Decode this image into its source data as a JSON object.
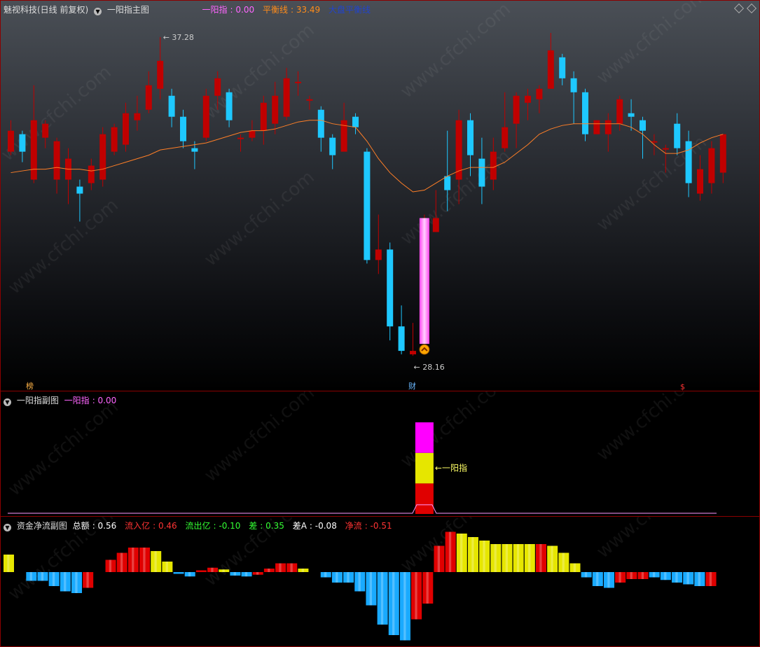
{
  "main": {
    "title": "魅视科技(日线 前复权)",
    "indicator_name": "一阳指主图",
    "legend": [
      {
        "label": "一阳指",
        "value": "0.00",
        "color": "#ff66ff"
      },
      {
        "label": "平衡线",
        "value": "33.49",
        "color": "#ff8c1a"
      },
      {
        "label": "大盘平衡线",
        "value": "",
        "color": "#2244cc"
      }
    ],
    "high_label": "37.28",
    "low_label": "28.16",
    "marker_bang": "榜",
    "marker_cai": "财",
    "marker_dollar": "$"
  },
  "sub1": {
    "indicator_name": "一阳指副图",
    "legend_label": "一阳指",
    "legend_value": "0.00",
    "annotation": "一阳指"
  },
  "sub2": {
    "indicator_name": "资金净流副图",
    "legend": [
      {
        "label": "总额",
        "value": "0.56",
        "color": "#ffffff"
      },
      {
        "label": "流入亿",
        "value": "0.46",
        "color": "#ff3333"
      },
      {
        "label": "流出亿",
        "value": "-0.10",
        "color": "#33ff33"
      },
      {
        "label": "差",
        "value": "0.35",
        "color": "#33ff33"
      },
      {
        "label": "差A",
        "value": "-0.08",
        "color": "#ffffff"
      },
      {
        "label": "净流",
        "value": "-0.51",
        "color": "#ff3333"
      }
    ]
  },
  "colors": {
    "up": "#c00000",
    "down": "#1ec8ff",
    "ma": "#ff7f27",
    "pink": "#ff66ff",
    "yellow": "#e6e600",
    "red": "#e00000",
    "blue": "#19aaff"
  },
  "watermark": "www.cfchi.com",
  "chart_data": [
    {
      "type": "candlestick",
      "ylim": [
        27.5,
        38.0
      ],
      "candles": [
        [
          34.0,
          34.6,
          34.9,
          33.9
        ],
        [
          34.5,
          34.0,
          34.6,
          33.7
        ],
        [
          33.2,
          34.9,
          35.9,
          33.1
        ],
        [
          34.4,
          34.8,
          34.9,
          34.1
        ],
        [
          33.2,
          34.3,
          34.4,
          32.8
        ],
        [
          33.2,
          33.8,
          34.1,
          32.5
        ],
        [
          33.0,
          32.8,
          33.2,
          32.0
        ],
        [
          33.1,
          33.6,
          33.8,
          32.9
        ],
        [
          33.2,
          34.5,
          34.7,
          33.0
        ],
        [
          34.0,
          34.7,
          34.8,
          33.9
        ],
        [
          34.2,
          35.1,
          35.4,
          34.0
        ],
        [
          34.9,
          35.1,
          35.6,
          34.6
        ],
        [
          35.2,
          35.9,
          36.3,
          35.1
        ],
        [
          35.8,
          36.6,
          37.28,
          35.5
        ],
        [
          35.6,
          35.0,
          35.8,
          34.7
        ],
        [
          35.0,
          34.3,
          35.2,
          34.1
        ],
        [
          34.1,
          34.0,
          34.3,
          33.5
        ],
        [
          34.4,
          35.6,
          35.8,
          34.3
        ],
        [
          35.6,
          36.1,
          36.3,
          35.2
        ],
        [
          35.7,
          34.9,
          35.8,
          34.7
        ],
        [
          34.4,
          34.4,
          34.5,
          34.0
        ],
        [
          34.4,
          34.6,
          34.9,
          34.3
        ],
        [
          34.6,
          35.4,
          35.6,
          34.2
        ],
        [
          34.8,
          35.6,
          36.0,
          34.5
        ],
        [
          35.0,
          36.1,
          36.4,
          34.9
        ],
        [
          36.0,
          36.0,
          36.3,
          35.6
        ],
        [
          35.5,
          35.5,
          35.6,
          35.2
        ],
        [
          35.2,
          34.4,
          35.3,
          34.0
        ],
        [
          34.4,
          33.9,
          34.5,
          33.5
        ],
        [
          34.0,
          34.9,
          35.4,
          34.0
        ],
        [
          35.0,
          34.7,
          35.1,
          34.5
        ],
        [
          34.0,
          30.9,
          34.1,
          30.8
        ],
        [
          30.9,
          31.2,
          32.2,
          30.5
        ],
        [
          31.2,
          29.0,
          31.4,
          28.6
        ],
        [
          29.0,
          28.3,
          29.6,
          28.2
        ],
        [
          28.2,
          28.3,
          29.1,
          28.16
        ],
        [
          30.0,
          32.1,
          32.2,
          29.7
        ],
        [
          31.7,
          32.1,
          32.9,
          32.0
        ],
        [
          33.3,
          32.9,
          34.6,
          32.3
        ],
        [
          33.2,
          34.9,
          35.2,
          32.5
        ],
        [
          34.9,
          33.9,
          35.1,
          33.3
        ],
        [
          33.8,
          33.0,
          34.4,
          32.5
        ],
        [
          33.2,
          34.0,
          34.4,
          32.9
        ],
        [
          34.1,
          34.7,
          35.7,
          34.0
        ],
        [
          34.8,
          35.6,
          35.7,
          34.1
        ],
        [
          35.4,
          35.6,
          35.8,
          34.9
        ],
        [
          35.5,
          35.8,
          35.9,
          35.1
        ],
        [
          35.8,
          36.9,
          37.4,
          35.8
        ],
        [
          36.7,
          36.1,
          36.8,
          35.9
        ],
        [
          36.1,
          35.7,
          36.3,
          34.8
        ],
        [
          35.7,
          34.5,
          35.8,
          34.3
        ],
        [
          34.5,
          34.9,
          34.9,
          34.5
        ],
        [
          34.5,
          34.9,
          35.1,
          34.0
        ],
        [
          34.8,
          35.5,
          35.6,
          34.6
        ],
        [
          35.1,
          35.0,
          35.5,
          34.6
        ],
        [
          34.9,
          34.6,
          35.0,
          33.8
        ],
        [
          34.3,
          34.3,
          34.5,
          33.9
        ],
        [
          34.1,
          34.1,
          34.2,
          33.4
        ],
        [
          34.8,
          34.1,
          35.1,
          33.9
        ],
        [
          34.3,
          33.1,
          34.6,
          32.7
        ],
        [
          32.8,
          33.5,
          33.9,
          32.6
        ],
        [
          33.1,
          34.1,
          34.3,
          32.8
        ],
        [
          33.4,
          34.5,
          34.5,
          33.1
        ]
      ],
      "ma_line": [
        33.4,
        33.45,
        33.5,
        33.5,
        33.55,
        33.5,
        33.5,
        33.45,
        33.5,
        33.6,
        33.7,
        33.8,
        33.9,
        34.05,
        34.1,
        34.15,
        34.2,
        34.25,
        34.35,
        34.45,
        34.55,
        34.6,
        34.6,
        34.65,
        34.75,
        34.85,
        34.9,
        34.9,
        34.8,
        34.75,
        34.7,
        34.3,
        33.8,
        33.4,
        33.1,
        32.85,
        32.9,
        33.1,
        33.3,
        33.45,
        33.55,
        33.55,
        33.55,
        33.7,
        33.95,
        34.2,
        34.5,
        34.65,
        34.75,
        34.8,
        34.8,
        34.8,
        34.8,
        34.8,
        34.7,
        34.5,
        34.2,
        33.95,
        33.95,
        34.05,
        34.25,
        34.4,
        34.5
      ],
      "signal_bar": {
        "index": 36,
        "bottom": 28.5,
        "top": 32.1
      }
    },
    {
      "type": "bar",
      "series": [
        {
          "name": "一阳指",
          "index": 36,
          "segments": [
            {
              "color": "#e00000",
              "from": 0,
              "to": 1
            },
            {
              "color": "#e6e600",
              "from": 1,
              "to": 2
            },
            {
              "color": "#ff00ff",
              "from": 2,
              "to": 3
            }
          ]
        }
      ],
      "ylim": [
        0,
        3.6
      ]
    },
    {
      "type": "bar",
      "values": [
        1.0,
        0,
        -0.5,
        -0.5,
        -0.8,
        -1.1,
        -1.2,
        -0.9,
        0,
        0.7,
        1.1,
        1.4,
        1.4,
        1.2,
        0.6,
        -0.1,
        -0.25,
        0.1,
        0.25,
        0.15,
        -0.2,
        -0.25,
        -0.15,
        0.2,
        0.5,
        0.5,
        0.2,
        0,
        -0.3,
        -0.6,
        -0.6,
        -1.1,
        -1.9,
        -3.0,
        -3.6,
        -3.9,
        -2.7,
        -1.8,
        1.5,
        2.3,
        2.2,
        2.0,
        1.8,
        1.6,
        1.6,
        1.6,
        1.6,
        1.6,
        1.5,
        1.1,
        0.5,
        -0.3,
        -0.8,
        -0.9,
        -0.6,
        -0.4,
        -0.4,
        -0.3,
        -0.45,
        -0.6,
        -0.7,
        -0.8,
        -0.8
      ],
      "colors": [
        "Y",
        "Y",
        "B",
        "B",
        "B",
        "B",
        "B",
        "R",
        "R",
        "R",
        "R",
        "R",
        "R",
        "Y",
        "Y",
        "B",
        "B",
        "R",
        "R",
        "Y",
        "B",
        "B",
        "R",
        "R",
        "R",
        "R",
        "Y",
        "Y",
        "B",
        "B",
        "B",
        "B",
        "B",
        "B",
        "B",
        "B",
        "R",
        "R",
        "R",
        "R",
        "Y",
        "Y",
        "Y",
        "Y",
        "Y",
        "Y",
        "Y",
        "R",
        "Y",
        "Y",
        "Y",
        "B",
        "B",
        "B",
        "R",
        "R",
        "R",
        "B",
        "B",
        "B",
        "B",
        "B",
        "R"
      ]
    }
  ]
}
